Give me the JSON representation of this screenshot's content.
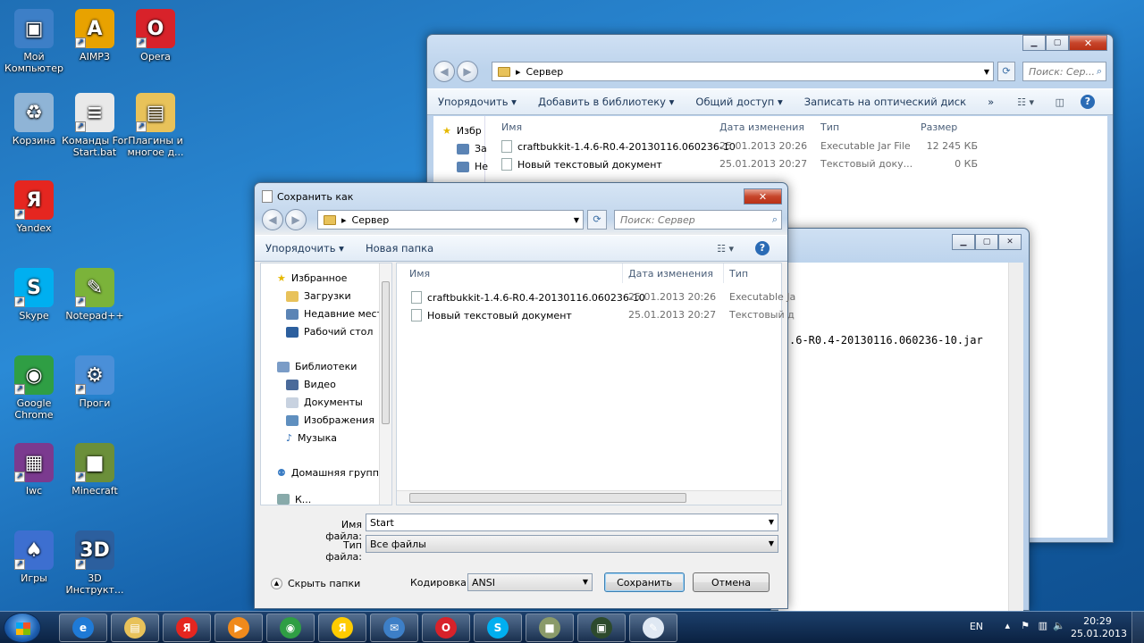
{
  "desktop": {
    "icons": [
      {
        "label": "Мой\nКомпьютер",
        "icon": "computer-icon"
      },
      {
        "label": "AIMP3",
        "icon": "aimp-icon"
      },
      {
        "label": "Opera",
        "icon": "opera-icon"
      },
      {
        "label": "Корзина",
        "icon": "recycle-bin-icon"
      },
      {
        "label": "Команды For\nStart.bat",
        "icon": "bat-file-icon"
      },
      {
        "label": "Плагины и\nмногое д...",
        "icon": "folder-icon"
      },
      {
        "label": "Yandex",
        "icon": "yandex-icon"
      },
      {
        "label": "Skype",
        "icon": "skype-icon"
      },
      {
        "label": "Notepad++",
        "icon": "notepadpp-icon"
      },
      {
        "label": "Google\nChrome",
        "icon": "chrome-icon"
      },
      {
        "label": "Проги",
        "icon": "programs-icon"
      },
      {
        "label": "Iwc",
        "icon": "winrar-icon"
      },
      {
        "label": "Minecraft",
        "icon": "minecraft-icon"
      },
      {
        "label": "Игры",
        "icon": "games-icon"
      },
      {
        "label": "3D\nИнструкт...",
        "icon": "3d-icon"
      }
    ]
  },
  "explorer": {
    "address": "Сервер",
    "search_placeholder": "Поиск: Сер...",
    "toolbar": [
      "Упорядочить ▾",
      "Добавить в библиотеку ▾",
      "Общий доступ ▾",
      "Записать на оптический диск",
      "»"
    ],
    "nav": [
      "Избр",
      "За",
      "Не"
    ],
    "columns": [
      "Имя",
      "Дата изменения",
      "Тип",
      "Размер"
    ],
    "rows": [
      {
        "name": "craftbukkit-1.4.6-R0.4-20130116.060236-10",
        "date": "25.01.2013 20:26",
        "type": "Executable Jar File",
        "size": "12 245 КБ"
      },
      {
        "name": "Новый текстовый документ",
        "date": "25.01.2013 20:27",
        "type": "Текстовый доку...",
        "size": "0 КБ"
      }
    ]
  },
  "notepad": {
    "text": ".6-R0.4-20130116.060236-10.jar"
  },
  "dialog": {
    "title": "Сохранить как",
    "address": "Сервер",
    "search_placeholder": "Поиск: Сервер",
    "toolbar": {
      "organize": "Упорядочить ▾",
      "new_folder": "Новая папка"
    },
    "nav": {
      "favorites": "Избранное",
      "downloads": "Загрузки",
      "recent": "Недавние места",
      "desktop": "Рабочий стол",
      "libraries": "Библиотеки",
      "video": "Видео",
      "documents": "Документы",
      "images": "Изображения",
      "music": "Музыка",
      "homegroup": "Домашняя группа",
      "computer": "К..."
    },
    "columns": [
      "Имя",
      "Дата изменения",
      "Тип"
    ],
    "rows": [
      {
        "name": "craftbukkit-1.4.6-R0.4-20130116.060236-10",
        "date": "25.01.2013 20:26",
        "type": "Executable Ja"
      },
      {
        "name": "Новый текстовый документ",
        "date": "25.01.2013 20:27",
        "type": "Текстовый д"
      }
    ],
    "filename_label": "Имя файла:",
    "filename_value": "Start",
    "filetype_label": "Тип файла:",
    "filetype_value": "Все файлы",
    "hide_folders": "Скрыть папки",
    "encoding_label": "Кодировка:",
    "encoding_value": "ANSI",
    "save": "Сохранить",
    "cancel": "Отмена"
  },
  "taskbar": {
    "lang": "EN",
    "time": "20:29",
    "date": "25.01.2013"
  }
}
